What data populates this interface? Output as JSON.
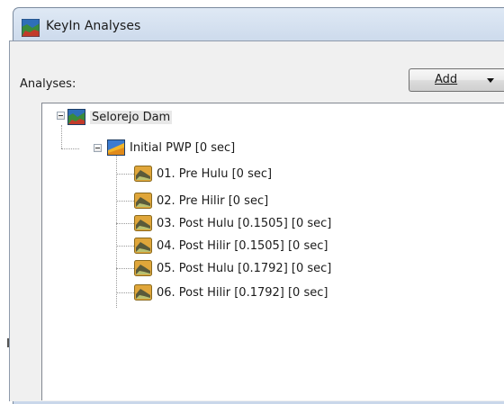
{
  "window": {
    "title": "KeyIn Analyses"
  },
  "panel": {
    "analyses_label": "Analyses:"
  },
  "add_button": {
    "label": "Add"
  },
  "tree": {
    "root": {
      "label": "Selorejo Dam"
    },
    "initial": {
      "label": "Initial PWP [0 sec]"
    },
    "items": [
      {
        "label": "01. Pre Hulu [0 sec]"
      },
      {
        "label": "02. Pre Hilir [0 sec]"
      },
      {
        "label": "03. Post Hulu [0.1505] [0 sec]"
      },
      {
        "label": "04. Post Hilir [0.1505] [0 sec]"
      },
      {
        "label": "05. Post Hulu [0.1792] [0 sec]"
      },
      {
        "label": "06. Post Hilir [0.1792] [0 sec]"
      }
    ]
  },
  "colors": {
    "title_bar": "#cfdced",
    "panel_bg": "#f0f0f0",
    "tree_bg": "#ffffff"
  },
  "icons": {
    "app": "keyin-analyses-icon",
    "root": "project-icon",
    "initial": "initial-pwp-icon",
    "child": "analysis-slope-icon"
  }
}
